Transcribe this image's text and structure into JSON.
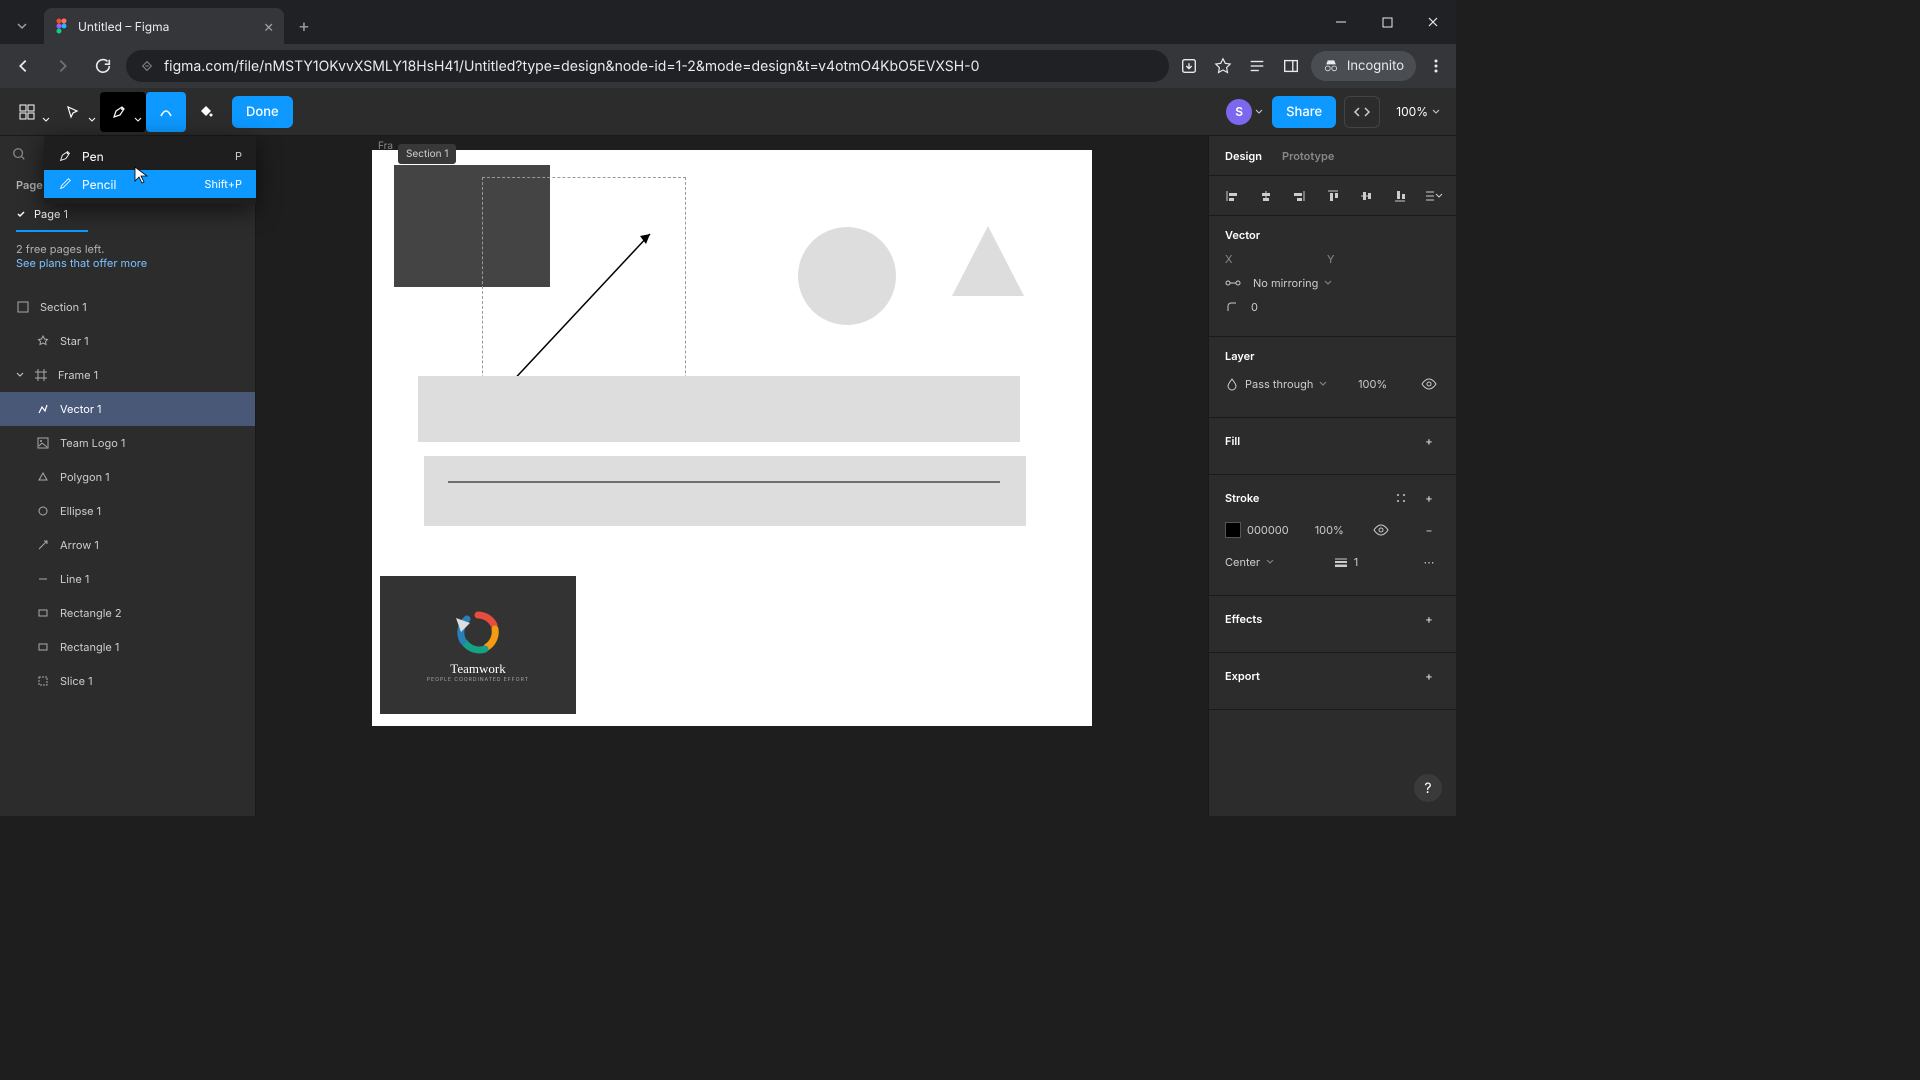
{
  "browser": {
    "tab_title": "Untitled – Figma",
    "url": "figma.com/file/nMSTY1OKvvXSMLY18HsH41/Untitled?type=design&node-id=1-2&mode=design&t=v4otmO4KbO5EVXSH-0",
    "incognito_label": "Incognito"
  },
  "toolbar": {
    "done_label": "Done",
    "share_label": "Share",
    "avatar_initial": "S",
    "zoom": "100%"
  },
  "tool_menu": {
    "items": [
      {
        "label": "Pen",
        "shortcut": "P"
      },
      {
        "label": "Pencil",
        "shortcut": "Shift+P"
      }
    ]
  },
  "left": {
    "pages_header": "Page",
    "page_name": "Page 1",
    "pages_left": "2 free pages left.",
    "see_plans": "See plans that offer more",
    "layers": [
      {
        "name": "Section 1",
        "indent": 0,
        "icon": "section"
      },
      {
        "name": "Star 1",
        "indent": 1,
        "icon": "star"
      },
      {
        "name": "Frame 1",
        "indent": 0,
        "icon": "frame",
        "expanded": true
      },
      {
        "name": "Vector 1",
        "indent": 1,
        "icon": "vector",
        "selected": true
      },
      {
        "name": "Team Logo 1",
        "indent": 1,
        "icon": "image"
      },
      {
        "name": "Polygon 1",
        "indent": 1,
        "icon": "polygon"
      },
      {
        "name": "Ellipse 1",
        "indent": 1,
        "icon": "ellipse"
      },
      {
        "name": "Arrow 1",
        "indent": 1,
        "icon": "arrow"
      },
      {
        "name": "Line 1",
        "indent": 1,
        "icon": "line"
      },
      {
        "name": "Rectangle 2",
        "indent": 1,
        "icon": "rect"
      },
      {
        "name": "Rectangle 1",
        "indent": 1,
        "icon": "rect"
      },
      {
        "name": "Slice 1",
        "indent": 1,
        "icon": "slice"
      }
    ]
  },
  "canvas": {
    "frame_label": "Fra",
    "section_badge": "Section 1",
    "teamwork_text": "Teamwork",
    "teamwork_sub": "PEOPLE COORDINATED EFFORT"
  },
  "right": {
    "tabs": {
      "design": "Design",
      "prototype": "Prototype"
    },
    "vector": {
      "title": "Vector",
      "x_label": "X",
      "y_label": "Y",
      "mirroring": "No mirroring",
      "corner": "0"
    },
    "layer": {
      "title": "Layer",
      "blend": "Pass through",
      "opacity": "100%"
    },
    "fill": {
      "title": "Fill"
    },
    "stroke": {
      "title": "Stroke",
      "color": "000000",
      "opacity": "100%",
      "align": "Center",
      "weight": "1"
    },
    "effects": {
      "title": "Effects"
    },
    "export": {
      "title": "Export"
    }
  }
}
